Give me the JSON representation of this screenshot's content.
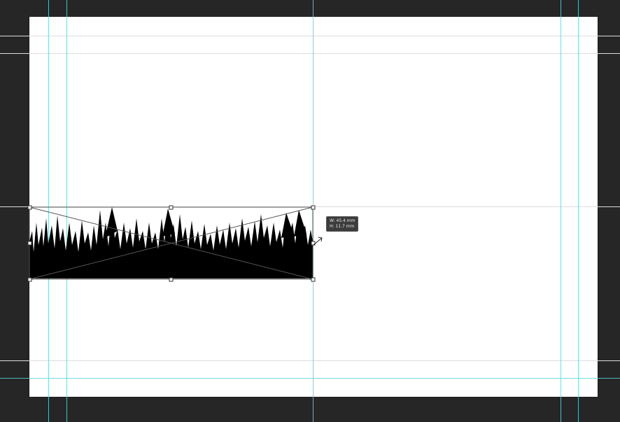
{
  "app": {
    "canvas_background": "#262626",
    "artboard_color": "#ffffff",
    "guide_color": "#5fd3d8"
  },
  "transform_tooltip": {
    "width_label": "W: 45.4 mm",
    "height_label": "H: 11.7 mm"
  },
  "selected_object": {
    "name": "grass-silhouette",
    "fill": "#000000"
  }
}
